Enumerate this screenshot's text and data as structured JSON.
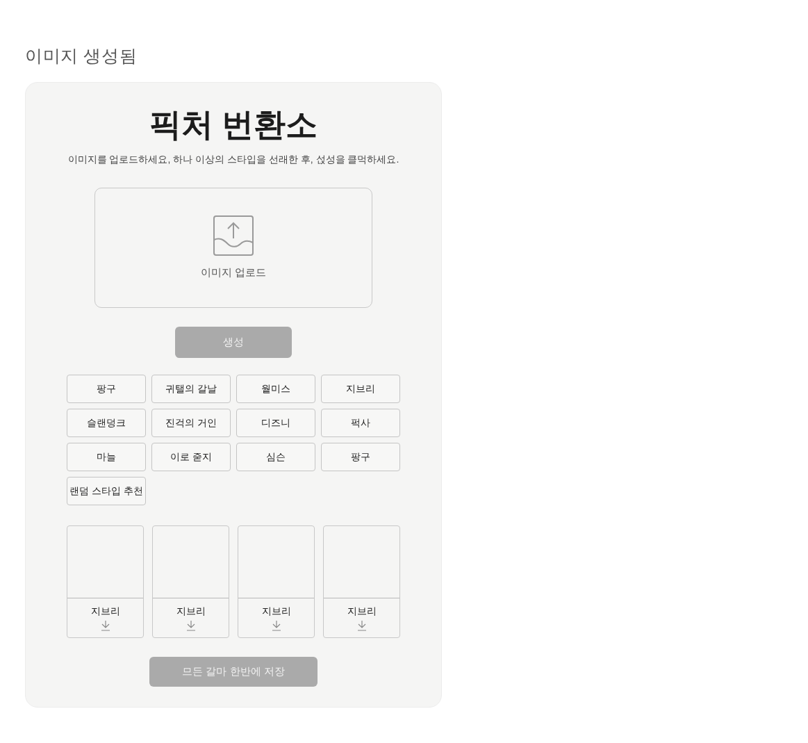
{
  "page_heading": "이미지 생성됨",
  "app": {
    "title": "픽처 번환소",
    "subtitle": "이미지를 업로드하세요, 하나 이상의 스타입을 선래한 후, 섡성을 클먹하세요.",
    "upload": {
      "label": "이미지 업로드"
    },
    "generate_button": {
      "label": "생성",
      "disabled": true
    },
    "styles": [
      {
        "label": "팡구",
        "selected": false
      },
      {
        "label": "귀탤의 갈날",
        "selected": false
      },
      {
        "label": "웥미스",
        "selected": false
      },
      {
        "label": "지브리",
        "selected": false
      },
      {
        "label": "슬랜덩크",
        "selected": false
      },
      {
        "label": "진걱의 거인",
        "selected": false
      },
      {
        "label": "디즈니",
        "selected": false
      },
      {
        "label": "퍽사",
        "selected": false
      },
      {
        "label": "마늘",
        "selected": false
      },
      {
        "label": "이로 줃지",
        "selected": false
      },
      {
        "label": "심슨",
        "selected": false
      },
      {
        "label": "팡구",
        "selected": false
      },
      {
        "label": "랜덤 스타입 추천",
        "selected": false
      }
    ],
    "results": [
      {
        "label": "지브리"
      },
      {
        "label": "지브리"
      },
      {
        "label": "지브리"
      },
      {
        "label": "지브리"
      }
    ],
    "save_all_button": {
      "label": "므든 갈마 한반에 저장",
      "disabled": true
    }
  }
}
